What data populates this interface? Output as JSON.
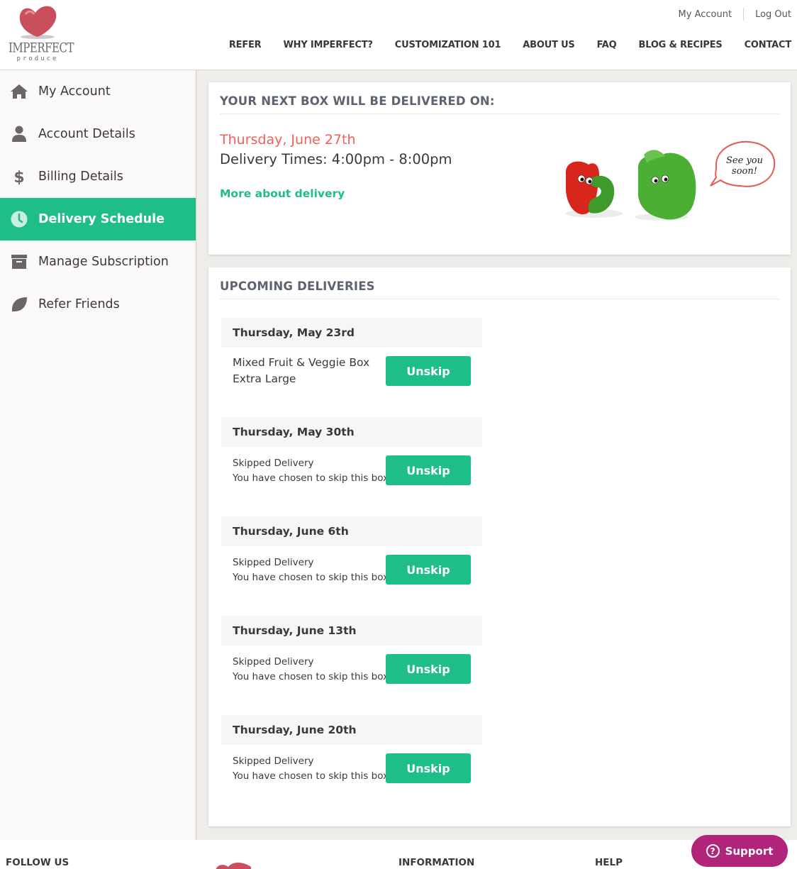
{
  "header": {
    "logo": {
      "brand": "IMPERFECT",
      "sub": "produce"
    },
    "top_links": [
      "My Account",
      "Log Out"
    ],
    "nav": [
      "REFER",
      "WHY IMPERFECT?",
      "CUSTOMIZATION 101",
      "ABOUT US",
      "FAQ",
      "BLOG & RECIPES",
      "CONTACT"
    ]
  },
  "sidebar": {
    "items": [
      {
        "label": "My Account",
        "icon": "home-icon",
        "active": false
      },
      {
        "label": "Account Details",
        "icon": "user-icon",
        "active": false
      },
      {
        "label": "Billing Details",
        "icon": "dollar-icon",
        "active": false
      },
      {
        "label": "Delivery Schedule",
        "icon": "clock-icon",
        "active": true
      },
      {
        "label": "Manage Subscription",
        "icon": "archive-box-icon",
        "active": false
      },
      {
        "label": "Refer Friends",
        "icon": "leaf-icon",
        "active": false
      }
    ]
  },
  "next_box": {
    "title": "YOUR NEXT BOX WILL BE DELIVERED ON:",
    "date": "Thursday, June 27th",
    "times": "Delivery Times: 4:00pm - 8:00pm",
    "more_link": "More about delivery",
    "speech_bubble": "See you soon!"
  },
  "upcoming": {
    "title": "UPCOMING DELIVERIES",
    "deliveries": [
      {
        "date": "Thursday, May 23rd",
        "line1": "Mixed Fruit & Veggie Box",
        "line2": "Extra Large",
        "skipped": false,
        "button": "Unskip"
      },
      {
        "date": "Thursday, May 30th",
        "line1": "Skipped Delivery",
        "line2": "You have chosen to skip this box.",
        "skipped": true,
        "button": "Unskip"
      },
      {
        "date": "Thursday, June 6th",
        "line1": "Skipped Delivery",
        "line2": "You have chosen to skip this box.",
        "skipped": true,
        "button": "Unskip"
      },
      {
        "date": "Thursday, June 13th",
        "line1": "Skipped Delivery",
        "line2": "You have chosen to skip this box.",
        "skipped": true,
        "button": "Unskip"
      },
      {
        "date": "Thursday, June 20th",
        "line1": "Skipped Delivery",
        "line2": "You have chosen to skip this box.",
        "skipped": true,
        "button": "Unskip"
      }
    ]
  },
  "footer": {
    "headings": [
      "FOLLOW US",
      "INFORMATION",
      "HELP"
    ]
  },
  "support": {
    "label": "Support"
  },
  "colors": {
    "accent_green": "#1fbe86",
    "date_red": "#f0605a",
    "support_magenta": "#b0247a"
  }
}
